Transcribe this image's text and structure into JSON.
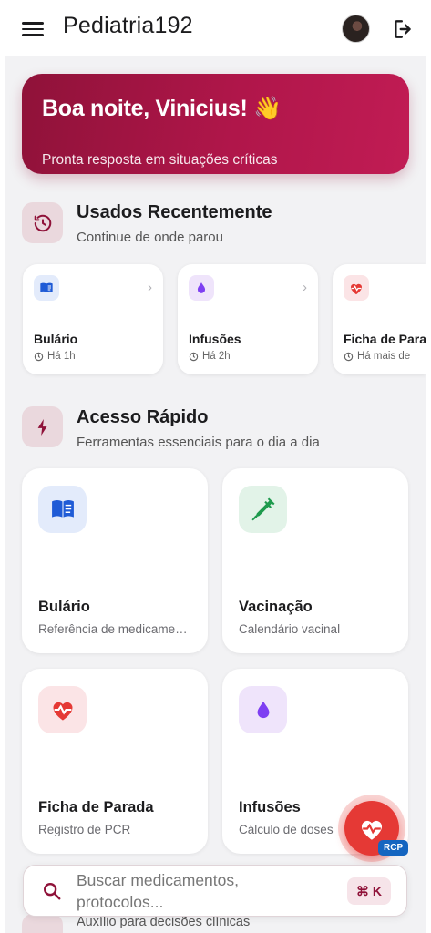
{
  "app": {
    "title": "Pediatria192"
  },
  "hero": {
    "greeting": "Boa noite, Vinicius! 👋",
    "subtitle": "Pronta resposta em situações críticas"
  },
  "recent": {
    "title": "Usados Recentemente",
    "subtitle": "Continue de onde parou",
    "items": [
      {
        "name": "Bulário",
        "time": "Há 1h",
        "icon": "book-icon"
      },
      {
        "name": "Infusões",
        "time": "Há 2h",
        "icon": "drop-icon"
      },
      {
        "name": "Ficha de Parada",
        "time": "Há mais de",
        "icon": "heart-pulse-icon"
      }
    ]
  },
  "quick": {
    "title": "Acesso Rápido",
    "subtitle": "Ferramentas essenciais para o dia a dia",
    "items": [
      {
        "name": "Bulário",
        "desc": "Referência de medicamentos",
        "icon": "book-icon"
      },
      {
        "name": "Vacinação",
        "desc": "Calendário vacinal",
        "icon": "syringe-icon"
      },
      {
        "name": "Ficha de Parada",
        "desc": "Registro de PCR",
        "icon": "heart-pulse-icon"
      },
      {
        "name": "Infusões",
        "desc": "Cálculo de doses",
        "icon": "drop-icon"
      }
    ]
  },
  "fab": {
    "badge": "RCP",
    "icon": "heart-pulse-icon"
  },
  "search": {
    "placeholder": "Buscar medicamentos, protocolos...",
    "shortcut": "⌘ K"
  },
  "next_section": {
    "subtitle": "Auxílio para decisões clínicas"
  },
  "colors": {
    "primary": "#8f1239",
    "accent": "#c11c54",
    "danger": "#e53935",
    "badge": "#1565c0"
  }
}
